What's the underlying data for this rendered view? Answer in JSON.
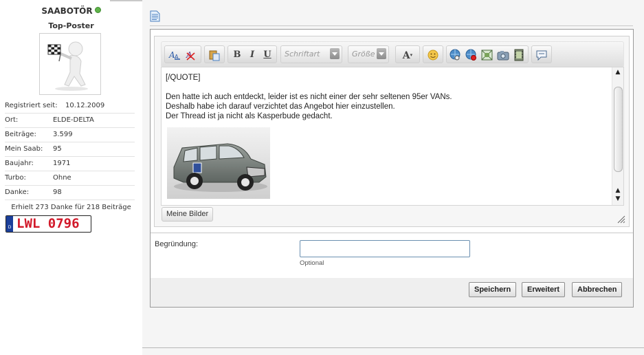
{
  "user": {
    "name": "SAABOTÖR",
    "title": "Top-Poster",
    "stats": [
      {
        "label": "Registriert seit:",
        "value": "10.12.2009"
      },
      {
        "label": "Ort:",
        "value": "ELDE-DELTA"
      },
      {
        "label": "Beiträge:",
        "value": "3.599"
      },
      {
        "label": "Mein Saab:",
        "value": "95"
      },
      {
        "label": "Baujahr:",
        "value": "1971"
      },
      {
        "label": "Turbo:",
        "value": "Ohne"
      },
      {
        "label": "Danke:",
        "value": "98"
      }
    ],
    "thanks_text": "Erhielt 273 Danke für 218 Beiträge",
    "plate": {
      "country": "D",
      "text": "LWL 0796"
    }
  },
  "toolbar": {
    "font_placeholder": "Schriftart",
    "size_placeholder": "Größe",
    "icons": [
      "font-color-icon",
      "remove-format-icon",
      "paste-icon",
      "bold-icon",
      "italic-icon",
      "underline-icon",
      "text-color-icon",
      "smiley-icon",
      "link-icon",
      "unlink-icon",
      "image-icon",
      "photo-icon",
      "video-icon",
      "quote-icon"
    ]
  },
  "content": {
    "line_top": "[/QUOTE]",
    "para1": "Den hatte ich auch entdeckt, leider ist es nicht einer der sehr seltenen 95er VANs.",
    "para2": "Deshalb habe ich darauf verzichtet das Angebot hier einzustellen.",
    "para3": "Der Thread ist ja nicht als Kasperbude gedacht."
  },
  "editor": {
    "my_images_label": "Meine Bilder"
  },
  "reason": {
    "label": "Begründung:",
    "value": "",
    "hint": "Optional"
  },
  "buttons": {
    "save": "Speichern",
    "advanced": "Erweitert",
    "cancel": "Abbrechen"
  }
}
